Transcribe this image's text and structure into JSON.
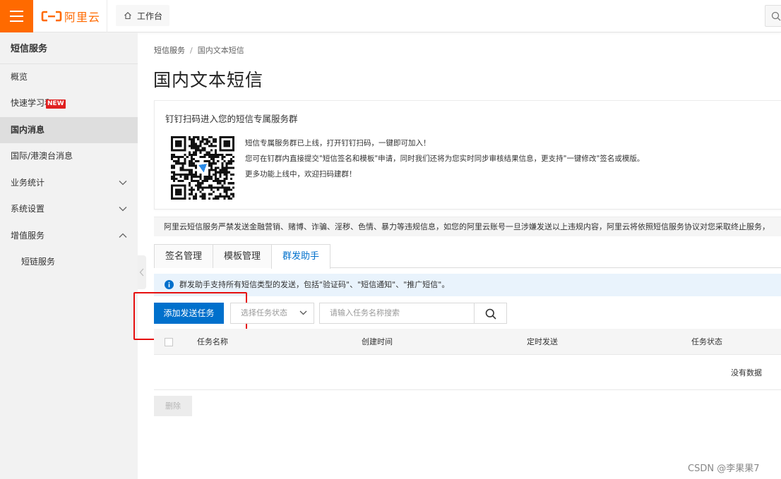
{
  "topbar": {
    "logo_text": "阿里云",
    "workbench_label": "工作台",
    "brand_color": "#ff6a00"
  },
  "sidebar": {
    "title": "短信服务",
    "items": [
      {
        "label": "概览"
      },
      {
        "label": "快速学习和",
        "badge": "NEW"
      },
      {
        "label": "国内消息",
        "active": true
      },
      {
        "label": "国际/港澳台消息"
      },
      {
        "label": "业务统计",
        "expandable": "chevron-down"
      },
      {
        "label": "系统设置",
        "expandable": "chevron-down"
      },
      {
        "label": "增值服务",
        "expandable": "chevron-up"
      },
      {
        "label": "短链服务",
        "sub": true
      }
    ]
  },
  "breadcrumb": {
    "root": "短信服务",
    "separator": "/",
    "current": "国内文本短信"
  },
  "page_title": "国内文本短信",
  "promo": {
    "title": "钉钉扫码进入您的短信专属服务群",
    "lines": [
      "短信专属服务群已上线，打开钉钉扫码，一键即可加入！",
      "您可在钉群内直接提交\"短信签名和模板\"申请，同时我们还将为您实时同步审核结果信息，更支持\"一键修改\"签名或模版。",
      "更多功能上线中，欢迎扫码建群！"
    ]
  },
  "notice": "阿里云短信服务严禁发送金融营销、赌博、诈骗、淫秽、色情、暴力等违规信息，如您的阿里云账号一旦涉嫌发送以上违规内容，阿里云将依照短信服务协议对您采取终止服务，",
  "tabs": [
    {
      "label": "签名管理"
    },
    {
      "label": "模板管理"
    },
    {
      "label": "群发助手",
      "active": true
    }
  ],
  "info_banner": "群发助手支持所有短信类型的发送，包括\"验证码\"、\"短信通知\"、\"推广短信\"。",
  "toolbar": {
    "add_task_label": "添加发送任务",
    "status_select_placeholder": "选择任务状态",
    "search_placeholder": "请输入任务名称搜索"
  },
  "table": {
    "columns": [
      "任务名称",
      "创建时间",
      "定时发送",
      "任务状态"
    ],
    "empty_text": "没有数据"
  },
  "delete_label": "删除",
  "watermark": "CSDN @李果果7",
  "colors": {
    "primary": "#0070cc",
    "highlight_frame": "#e60f0f",
    "info_bg": "#e9f3fc"
  }
}
